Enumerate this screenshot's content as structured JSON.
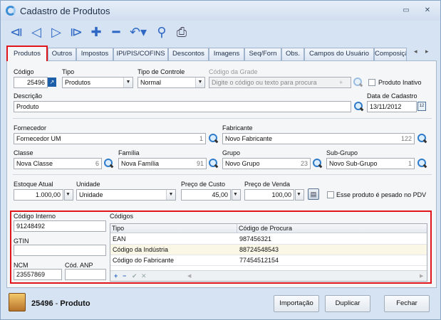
{
  "window": {
    "title": "Cadastro de Produtos",
    "minimize": "▭",
    "close": "✕"
  },
  "toolbar": [
    "first-icon",
    "prev-icon",
    "next-icon",
    "last-icon",
    "add-icon",
    "remove-icon",
    "undo-icon",
    "search-icon",
    "print-icon"
  ],
  "tabs": [
    "Produtos",
    "Outros",
    "Impostos",
    "IPI/PIS/COFINS",
    "Descontos",
    "Imagens",
    "Seq/Forn",
    "Obs.",
    "Campos do Usuário",
    "Composiçã"
  ],
  "form": {
    "codigo_label": "Código",
    "codigo": "25496",
    "tipo_label": "Tipo",
    "tipo": "Produtos",
    "tipo_controle_label": "Tipo de Controle",
    "tipo_controle": "Normal",
    "codigo_grade_label": "Código da Grade",
    "codigo_grade_placeholder": "Digite o código ou texto para procura",
    "produto_inativo_label": "Produto Inativo",
    "descricao_label": "Descrição",
    "descricao": "Produto",
    "data_cadastro_label": "Data de Cadastro",
    "data_cadastro": "13/11/2012",
    "calendar_day": "12",
    "fornecedor_label": "Fornecedor",
    "fornecedor": "Fornecedor UM",
    "fornecedor_num": "1",
    "fabricante_label": "Fabricante",
    "fabricante": "Novo Fabricante",
    "fabricante_num": "122",
    "classe_label": "Classe",
    "classe": "Nova Classe",
    "classe_num": "6",
    "familia_label": "Família",
    "familia": "Nova Família",
    "familia_num": "91",
    "grupo_label": "Grupo",
    "grupo": "Novo Grupo",
    "grupo_num": "23",
    "subgrupo_label": "Sub-Grupo",
    "subgrupo": "Novo Sub-Grupo",
    "subgrupo_num": "1",
    "estoque_label": "Estoque Atual",
    "estoque": "1.000,00",
    "unidade_label": "Unidade",
    "unidade": "Unidade",
    "preco_custo_label": "Preço de Custo",
    "preco_custo": "45,00",
    "preco_venda_label": "Preço de Venda",
    "preco_venda": "100,00",
    "pesado_label": "Esse produto é pesado no PDV",
    "codigo_interno_label": "Código Interno",
    "codigo_interno": "91248492",
    "gtin_label": "GTIN",
    "gtin": "",
    "ncm_label": "NCM",
    "ncm": "23557869",
    "cod_anp_label": "Cód. ANP",
    "cod_anp": ""
  },
  "codigos": {
    "label": "Códigos",
    "columns": [
      "Tipo",
      "Código de Procura"
    ],
    "rows": [
      [
        "EAN",
        "987456321"
      ],
      [
        "Código da Indústria",
        "88724548543"
      ],
      [
        "Código do Fabricante",
        "77454512154"
      ]
    ]
  },
  "status": {
    "code": "25496",
    "sep": " - ",
    "name": "Produto"
  },
  "buttons": {
    "importacao": "Importação",
    "duplicar": "Duplicar",
    "fechar": "Fechar"
  }
}
